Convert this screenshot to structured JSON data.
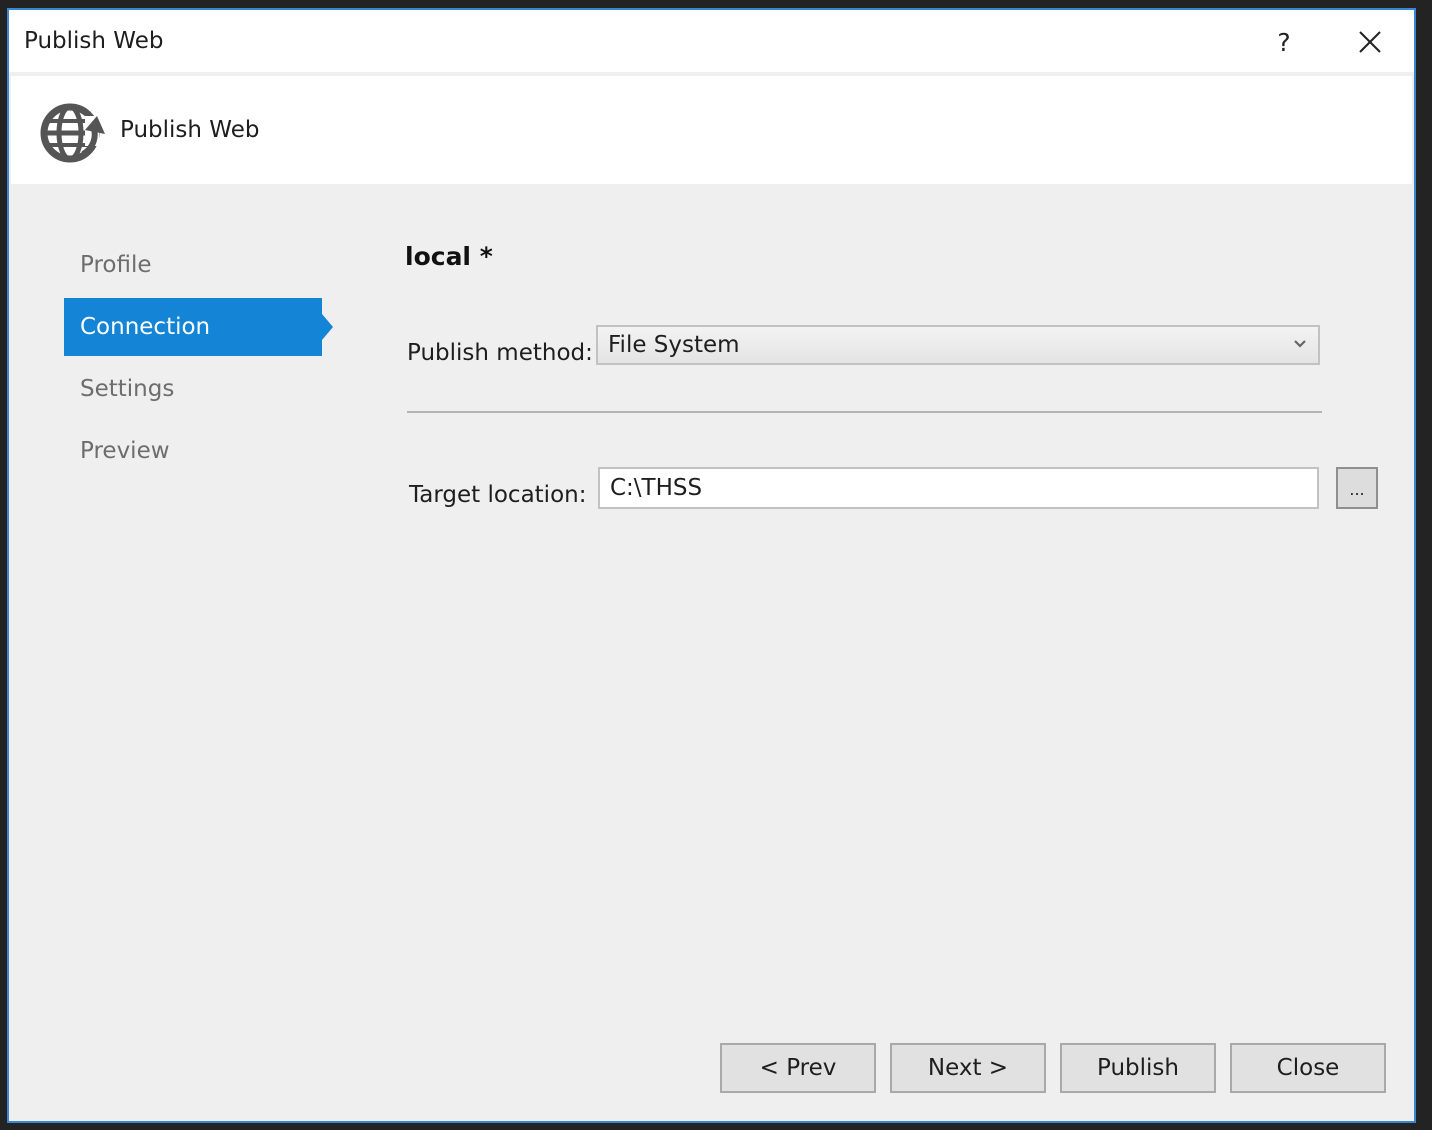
{
  "window": {
    "title": "Publish Web",
    "help_label": "?",
    "close_icon": "close-icon"
  },
  "header": {
    "icon": "globe-publish-icon",
    "title": "Publish Web"
  },
  "nav": {
    "items": [
      {
        "label": "Profile",
        "active": false
      },
      {
        "label": "Connection",
        "active": true
      },
      {
        "label": "Settings",
        "active": false
      },
      {
        "label": "Preview",
        "active": false
      }
    ]
  },
  "main": {
    "profile_name": "local *",
    "publish_method": {
      "label": "Publish method:",
      "value": "File System"
    },
    "target_location": {
      "label": "Target location:",
      "value": "C:\\THSS",
      "browse_label": "..."
    }
  },
  "footer": {
    "prev_label": "< Prev",
    "next_label": "Next >",
    "publish_label": "Publish",
    "close_label": "Close"
  },
  "colors": {
    "accent": "#1484d6",
    "window_border": "#3a86d0",
    "body_bg": "#efefef",
    "desktop_bg": "#232323"
  }
}
